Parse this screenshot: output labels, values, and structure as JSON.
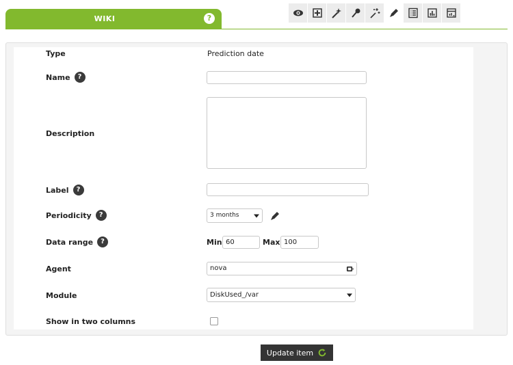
{
  "header": {
    "tab_label": "WIKI",
    "help_glyph": "?",
    "accent_color": "#82b92e",
    "toolbar_icons": [
      "eye-icon",
      "plus-box-icon",
      "magic-wand-icon",
      "pin-icon",
      "wizard-sparkle-icon",
      "pencil-icon",
      "list-icon",
      "bar-chart-icon",
      "table-chart-icon"
    ]
  },
  "form": {
    "type": {
      "label": "Type",
      "value": "Prediction date"
    },
    "name": {
      "label": "Name",
      "value": ""
    },
    "description": {
      "label": "Description",
      "value": ""
    },
    "label_field": {
      "label": "Label",
      "value": ""
    },
    "periodicity": {
      "label": "Periodicity",
      "value": "3 months"
    },
    "data_range": {
      "label": "Data range",
      "min_label": "Min.",
      "min_value": "60",
      "max_label": "Max.",
      "max_value": "100"
    },
    "agent": {
      "label": "Agent",
      "value": "nova"
    },
    "module": {
      "label": "Module",
      "value": "DiskUsed_/var"
    },
    "two_columns": {
      "label": "Show in two columns",
      "checked": false
    }
  },
  "actions": {
    "update_label": "Update item"
  }
}
